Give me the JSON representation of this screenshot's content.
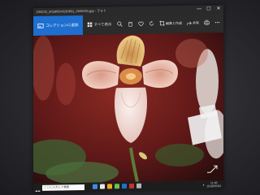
{
  "window": {
    "title": "DSC03_20180504130831_0000001.jpg - フォト",
    "controls": [
      "—",
      "☐",
      "✕"
    ]
  },
  "toolbar": {
    "tabs": [
      {
        "label": "コレクションに追加",
        "icon": "image-icon"
      },
      {
        "label": "すべて表示",
        "icon": "grid-icon"
      }
    ],
    "tools": [
      "zoom-icon",
      "delete-icon",
      "favorite-icon",
      "rotate-icon",
      "crop-icon"
    ],
    "edit_label": "編集と作成",
    "share_label": "共有",
    "print_icon": "print-icon",
    "more_icon": "more-icon"
  },
  "photo": {
    "subject": "paphiopedilum orchid",
    "colors": {
      "petal": "#f0c2b7",
      "pouch": "#f4e2de",
      "background": "#6b1a1a",
      "foliage": "#4b6b3c",
      "dorsal": "#e3b55a"
    }
  },
  "taskbar": {
    "search_placeholder": "ここに入力して検索",
    "time": "11:46",
    "date": "2018/05/03",
    "app_colors": [
      "#3c8de0",
      "#e8e8e8",
      "#f3a81c",
      "#6dc24b",
      "#1e6fd0",
      "#c3332c",
      "#b5b5b5"
    ]
  },
  "accent": "#1e6fd0"
}
